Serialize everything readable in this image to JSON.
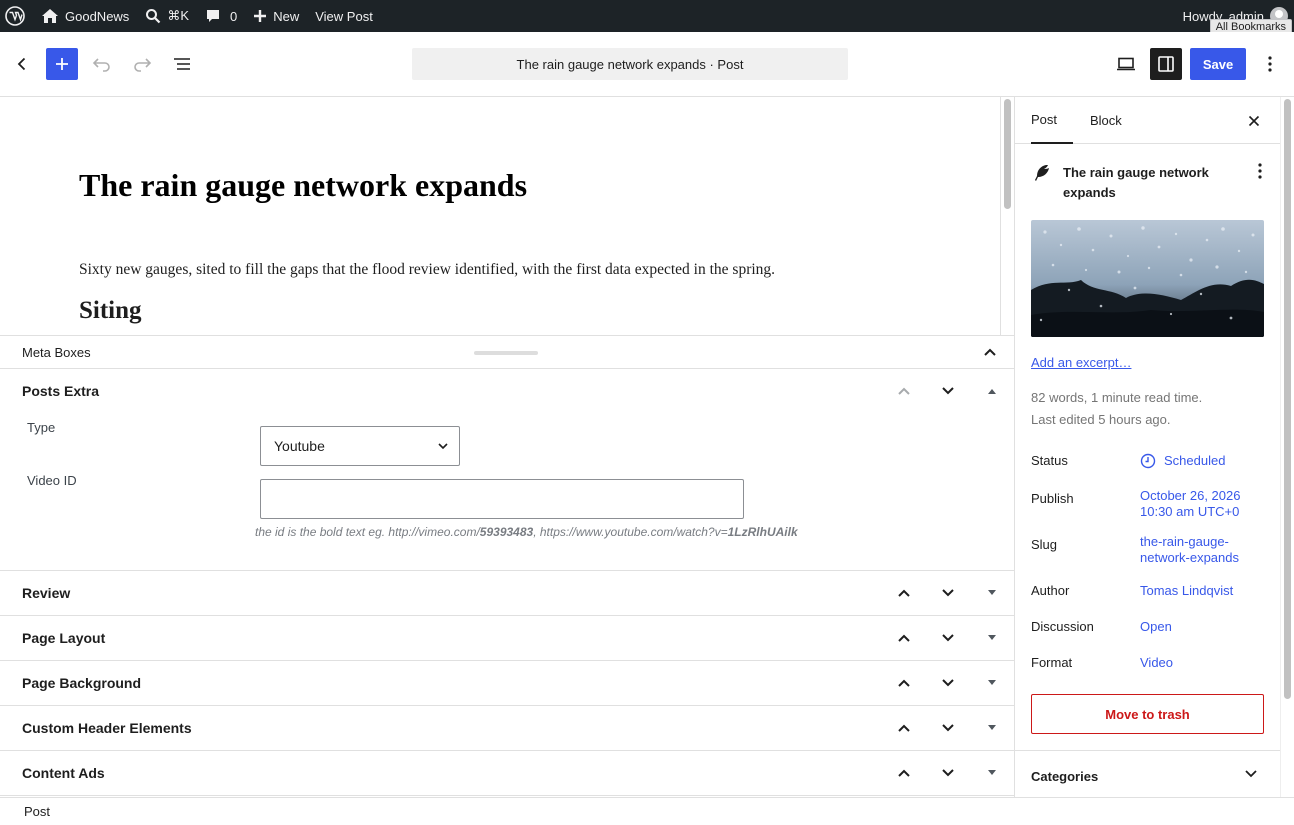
{
  "admin_bar": {
    "site_name": "GoodNews",
    "search_shortcut": "⌘K",
    "comments_count": "0",
    "new_label": "New",
    "view_post_label": "View Post",
    "howdy": "Howdy, admin",
    "tooltip": "All Bookmarks"
  },
  "header": {
    "document_title": "The rain gauge network expands · Post",
    "save_label": "Save"
  },
  "content": {
    "title": "The rain gauge network expands",
    "paragraph": "Sixty new gauges, sited to fill the gaps that the flood review identified, with the first data expected in the spring.",
    "heading": "Siting"
  },
  "meta_boxes": {
    "title": "Meta Boxes",
    "posts_extra": {
      "title": "Posts Extra",
      "type_label": "Type",
      "type_value": "Youtube",
      "video_id_label": "Video ID",
      "video_id_value": "",
      "hint_prefix": "the id is the bold text eg. http://vimeo.com/",
      "hint_vimeo_id": "59393483",
      "hint_mid": ", https://www.youtube.com/watch?v=",
      "hint_yt_id": "1LzRlhUAilk"
    },
    "boxes": [
      {
        "title": "Review"
      },
      {
        "title": "Page Layout"
      },
      {
        "title": "Page Background"
      },
      {
        "title": "Custom Header Elements"
      },
      {
        "title": "Content Ads"
      }
    ]
  },
  "sidebar": {
    "tabs": [
      "Post",
      "Block"
    ],
    "post_title": "The rain gauge network expands",
    "excerpt_link": "Add an excerpt…",
    "stats_line1": "82 words, 1 minute read time.",
    "stats_line2": "Last edited 5 hours ago.",
    "rows": {
      "status_label": "Status",
      "status_value": "Scheduled",
      "publish_label": "Publish",
      "publish_value_1": "October 26, 2026",
      "publish_value_2": "10:30 am UTC+0",
      "slug_label": "Slug",
      "slug_value_1": "the-rain-gauge-",
      "slug_value_2": "network-expands",
      "author_label": "Author",
      "author_value": "Tomas Lindqvist",
      "discussion_label": "Discussion",
      "discussion_value": "Open",
      "format_label": "Format",
      "format_value": "Video"
    },
    "trash_label": "Move to trash",
    "categories_label": "Categories"
  },
  "footer": {
    "breadcrumb": "Post"
  },
  "colors": {
    "accent": "#3858e9",
    "admin_bar": "#1d2327",
    "danger": "#cc1818"
  }
}
